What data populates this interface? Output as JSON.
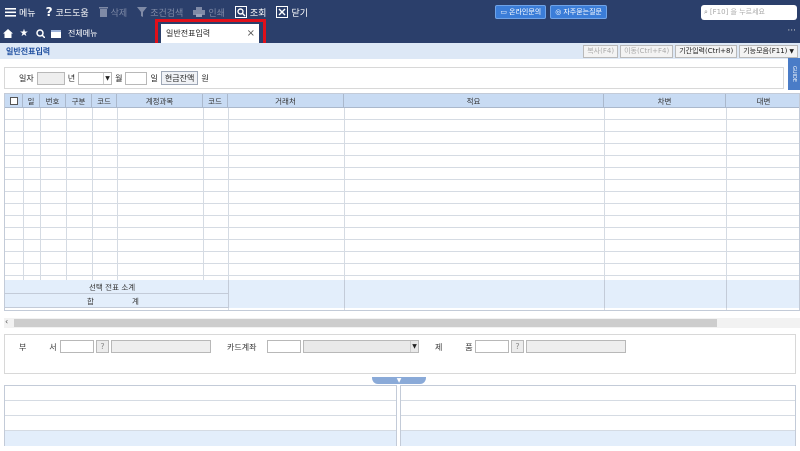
{
  "toolbar": {
    "menu": "메뉴",
    "code_help": "코드도움",
    "delete": "삭제",
    "filter": "조건검색",
    "print": "인쇄",
    "search": "조회",
    "close": "닫기",
    "online_consult": "온라인문의",
    "faq": "자주묻는질문",
    "search_placeholder": "[F10] 을 누르세요"
  },
  "tabs": {
    "all_menu": "전체메뉴",
    "active": "일반전표입력"
  },
  "page": {
    "title": "일반전표입력",
    "buttons": {
      "copy": "복사(F4)",
      "move": "이동(Ctrl+F4)",
      "period": "기간입력(Ctrl+8)",
      "features": "기능모음(F11)"
    },
    "guide": "GUIDE"
  },
  "date_row": {
    "date_label": "일자",
    "year_suffix": "년",
    "month_suffix": "월",
    "day_suffix": "일",
    "cash_balance": "현금잔액",
    "won": "원"
  },
  "grid": {
    "columns": [
      "일",
      "번호",
      "구분",
      "코드",
      "계정과목",
      "코드",
      "거래처",
      "적요",
      "차변",
      "대변"
    ],
    "subtotal_label": "선택 전표 소계",
    "total_label": "합                계"
  },
  "bottom_panel": {
    "dept_label": "부         서",
    "card_label": "카드계좌",
    "product_label": "제         품",
    "q": "?"
  }
}
